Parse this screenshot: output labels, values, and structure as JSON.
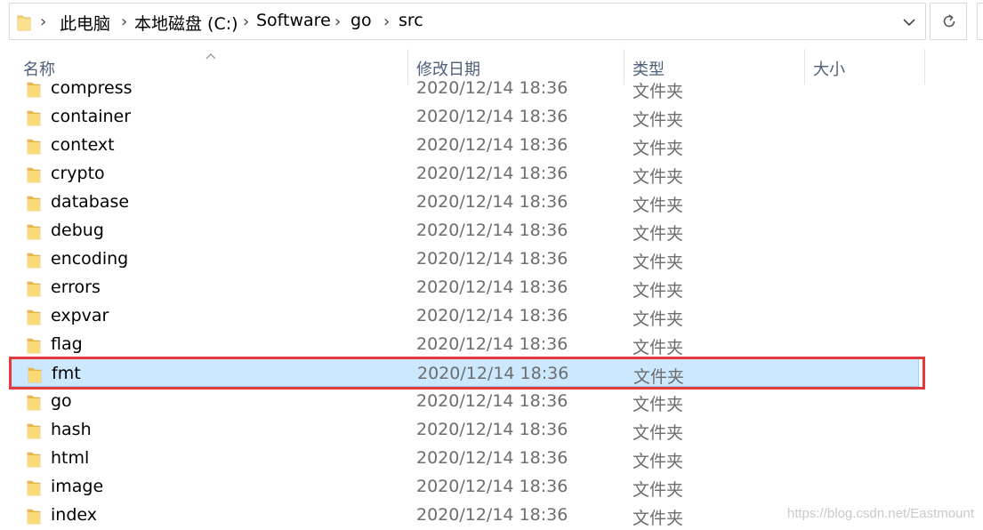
{
  "address_bar": {
    "breadcrumbs": [
      "此电脑",
      "本地磁盘 (C:)",
      "Software",
      "go",
      "src"
    ]
  },
  "columns": {
    "name": "名称",
    "date": "修改日期",
    "type": "类型",
    "size": "大小"
  },
  "files": [
    {
      "name": "compress",
      "date": "2020/12/14 18:36",
      "type": "文件夹"
    },
    {
      "name": "container",
      "date": "2020/12/14 18:36",
      "type": "文件夹"
    },
    {
      "name": "context",
      "date": "2020/12/14 18:36",
      "type": "文件夹"
    },
    {
      "name": "crypto",
      "date": "2020/12/14 18:36",
      "type": "文件夹"
    },
    {
      "name": "database",
      "date": "2020/12/14 18:36",
      "type": "文件夹"
    },
    {
      "name": "debug",
      "date": "2020/12/14 18:36",
      "type": "文件夹"
    },
    {
      "name": "encoding",
      "date": "2020/12/14 18:36",
      "type": "文件夹"
    },
    {
      "name": "errors",
      "date": "2020/12/14 18:36",
      "type": "文件夹"
    },
    {
      "name": "expvar",
      "date": "2020/12/14 18:36",
      "type": "文件夹"
    },
    {
      "name": "flag",
      "date": "2020/12/14 18:36",
      "type": "文件夹"
    },
    {
      "name": "fmt",
      "date": "2020/12/14 18:36",
      "type": "文件夹"
    },
    {
      "name": "go",
      "date": "2020/12/14 18:36",
      "type": "文件夹"
    },
    {
      "name": "hash",
      "date": "2020/12/14 18:36",
      "type": "文件夹"
    },
    {
      "name": "html",
      "date": "2020/12/14 18:36",
      "type": "文件夹"
    },
    {
      "name": "image",
      "date": "2020/12/14 18:36",
      "type": "文件夹"
    },
    {
      "name": "index",
      "date": "2020/12/14 18:36",
      "type": "文件夹"
    }
  ],
  "selected_item": "fmt",
  "watermark": "https://blog.csdn.net/Eastmount",
  "colors": {
    "selection_bg": "#cce8ff",
    "selection_border": "#99d1ff",
    "highlight_box": "#e33b3b",
    "header_text": "#4c607a",
    "folder_yellow": "#f8d775"
  },
  "icons": {
    "folder": "folder-icon",
    "dropdown": "chevron-down-icon",
    "refresh": "refresh-icon",
    "sort": "sort-up-icon",
    "separator": "chevron-right-icon"
  }
}
